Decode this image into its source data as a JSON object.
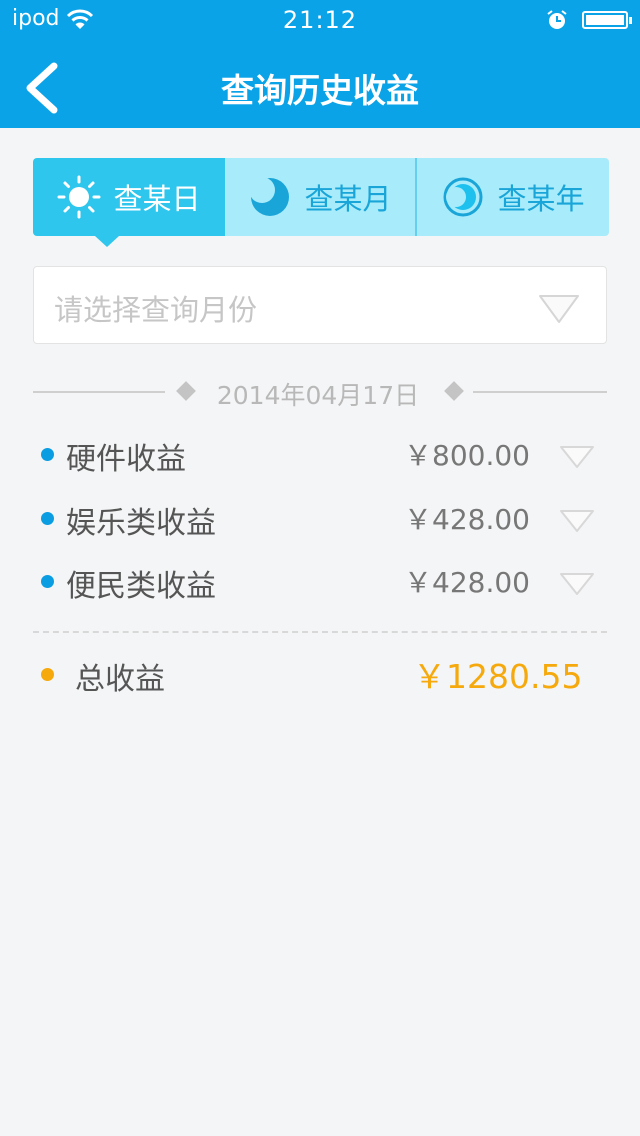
{
  "status_bar": {
    "carrier": "ipod",
    "time": "21:12"
  },
  "nav": {
    "title": "查询历史收益"
  },
  "tabs": [
    {
      "label": "查某日",
      "icon": "sun-icon",
      "selected": true
    },
    {
      "label": "查某月",
      "icon": "moon-icon",
      "selected": false
    },
    {
      "label": "查某年",
      "icon": "crescent-icon",
      "selected": false
    }
  ],
  "month_select": {
    "placeholder": "请选择查询月份"
  },
  "date_header": "2014年04月17日",
  "income_rows": [
    {
      "label": "硬件收益",
      "value": "￥800.00"
    },
    {
      "label": "娱乐类收益",
      "value": "￥428.00"
    },
    {
      "label": "便民类收益",
      "value": "￥428.00"
    }
  ],
  "total": {
    "label": "总收益",
    "value": "￥1280.55"
  },
  "colors": {
    "primary": "#0aa3e8",
    "tab_active": "#2ec6ec",
    "tab_inactive": "#a8ecfb",
    "accent_total": "#f5a90c",
    "bullet": "#0b9de2"
  }
}
